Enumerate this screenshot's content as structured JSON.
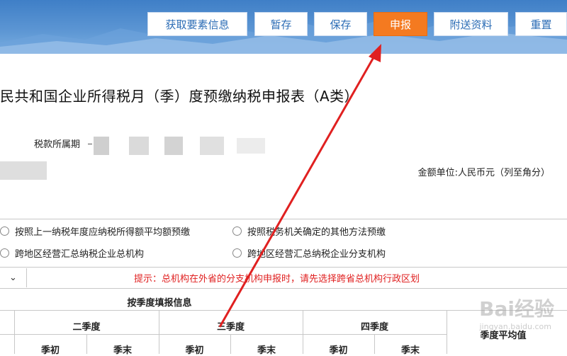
{
  "toolbar": {
    "get_info": "获取要素信息",
    "save_temp": "暂存",
    "save": "保存",
    "submit": "申报",
    "attach": "附送资料",
    "reset": "重置"
  },
  "form": {
    "title": "民共和国企业所得税月（季）度预缴纳税申报表（A类）",
    "period_label": "税款所属期",
    "unit_label": "金额单位:人民币元（列至角分）"
  },
  "options": [
    {
      "label": "按照上一纳税年度应纳税所得额平均额预缴"
    },
    {
      "label": "按照税务机关确定的其他方法预缴"
    },
    {
      "label": "跨地区经营汇总纳税企业总机构"
    },
    {
      "label": "跨地区经营汇总纳税企业分支机构"
    }
  ],
  "dropdown": {
    "value": ""
  },
  "hint": "提示：总机构在外省的分支机构申报时，请先选择跨省总机构行政区划",
  "table": {
    "section_header": "按季度填报信息",
    "quarters": [
      "二季度",
      "三季度",
      "四季度"
    ],
    "subcols": [
      "季初",
      "季末",
      "季初",
      "季末",
      "季初",
      "季末"
    ],
    "avg_label": "季度平均值"
  },
  "watermark": {
    "main": "Bai经验",
    "sub": "jingyan.baidu.com"
  },
  "colors": {
    "accent": "#f47a20",
    "arrow": "#e02020",
    "topbar": "#4a89cf"
  }
}
